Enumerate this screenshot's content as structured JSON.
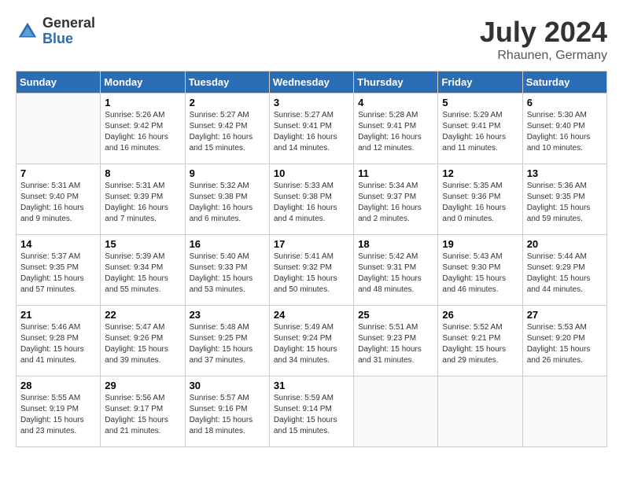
{
  "logo": {
    "general": "General",
    "blue": "Blue"
  },
  "title": {
    "month_year": "July 2024",
    "location": "Rhaunen, Germany"
  },
  "header_days": [
    "Sunday",
    "Monday",
    "Tuesday",
    "Wednesday",
    "Thursday",
    "Friday",
    "Saturday"
  ],
  "weeks": [
    {
      "days": [
        {
          "number": "",
          "info": ""
        },
        {
          "number": "1",
          "info": "Sunrise: 5:26 AM\nSunset: 9:42 PM\nDaylight: 16 hours\nand 16 minutes."
        },
        {
          "number": "2",
          "info": "Sunrise: 5:27 AM\nSunset: 9:42 PM\nDaylight: 16 hours\nand 15 minutes."
        },
        {
          "number": "3",
          "info": "Sunrise: 5:27 AM\nSunset: 9:41 PM\nDaylight: 16 hours\nand 14 minutes."
        },
        {
          "number": "4",
          "info": "Sunrise: 5:28 AM\nSunset: 9:41 PM\nDaylight: 16 hours\nand 12 minutes."
        },
        {
          "number": "5",
          "info": "Sunrise: 5:29 AM\nSunset: 9:41 PM\nDaylight: 16 hours\nand 11 minutes."
        },
        {
          "number": "6",
          "info": "Sunrise: 5:30 AM\nSunset: 9:40 PM\nDaylight: 16 hours\nand 10 minutes."
        }
      ]
    },
    {
      "days": [
        {
          "number": "7",
          "info": "Sunrise: 5:31 AM\nSunset: 9:40 PM\nDaylight: 16 hours\nand 9 minutes."
        },
        {
          "number": "8",
          "info": "Sunrise: 5:31 AM\nSunset: 9:39 PM\nDaylight: 16 hours\nand 7 minutes."
        },
        {
          "number": "9",
          "info": "Sunrise: 5:32 AM\nSunset: 9:38 PM\nDaylight: 16 hours\nand 6 minutes."
        },
        {
          "number": "10",
          "info": "Sunrise: 5:33 AM\nSunset: 9:38 PM\nDaylight: 16 hours\nand 4 minutes."
        },
        {
          "number": "11",
          "info": "Sunrise: 5:34 AM\nSunset: 9:37 PM\nDaylight: 16 hours\nand 2 minutes."
        },
        {
          "number": "12",
          "info": "Sunrise: 5:35 AM\nSunset: 9:36 PM\nDaylight: 16 hours\nand 0 minutes."
        },
        {
          "number": "13",
          "info": "Sunrise: 5:36 AM\nSunset: 9:35 PM\nDaylight: 15 hours\nand 59 minutes."
        }
      ]
    },
    {
      "days": [
        {
          "number": "14",
          "info": "Sunrise: 5:37 AM\nSunset: 9:35 PM\nDaylight: 15 hours\nand 57 minutes."
        },
        {
          "number": "15",
          "info": "Sunrise: 5:39 AM\nSunset: 9:34 PM\nDaylight: 15 hours\nand 55 minutes."
        },
        {
          "number": "16",
          "info": "Sunrise: 5:40 AM\nSunset: 9:33 PM\nDaylight: 15 hours\nand 53 minutes."
        },
        {
          "number": "17",
          "info": "Sunrise: 5:41 AM\nSunset: 9:32 PM\nDaylight: 15 hours\nand 50 minutes."
        },
        {
          "number": "18",
          "info": "Sunrise: 5:42 AM\nSunset: 9:31 PM\nDaylight: 15 hours\nand 48 minutes."
        },
        {
          "number": "19",
          "info": "Sunrise: 5:43 AM\nSunset: 9:30 PM\nDaylight: 15 hours\nand 46 minutes."
        },
        {
          "number": "20",
          "info": "Sunrise: 5:44 AM\nSunset: 9:29 PM\nDaylight: 15 hours\nand 44 minutes."
        }
      ]
    },
    {
      "days": [
        {
          "number": "21",
          "info": "Sunrise: 5:46 AM\nSunset: 9:28 PM\nDaylight: 15 hours\nand 41 minutes."
        },
        {
          "number": "22",
          "info": "Sunrise: 5:47 AM\nSunset: 9:26 PM\nDaylight: 15 hours\nand 39 minutes."
        },
        {
          "number": "23",
          "info": "Sunrise: 5:48 AM\nSunset: 9:25 PM\nDaylight: 15 hours\nand 37 minutes."
        },
        {
          "number": "24",
          "info": "Sunrise: 5:49 AM\nSunset: 9:24 PM\nDaylight: 15 hours\nand 34 minutes."
        },
        {
          "number": "25",
          "info": "Sunrise: 5:51 AM\nSunset: 9:23 PM\nDaylight: 15 hours\nand 31 minutes."
        },
        {
          "number": "26",
          "info": "Sunrise: 5:52 AM\nSunset: 9:21 PM\nDaylight: 15 hours\nand 29 minutes."
        },
        {
          "number": "27",
          "info": "Sunrise: 5:53 AM\nSunset: 9:20 PM\nDaylight: 15 hours\nand 26 minutes."
        }
      ]
    },
    {
      "days": [
        {
          "number": "28",
          "info": "Sunrise: 5:55 AM\nSunset: 9:19 PM\nDaylight: 15 hours\nand 23 minutes."
        },
        {
          "number": "29",
          "info": "Sunrise: 5:56 AM\nSunset: 9:17 PM\nDaylight: 15 hours\nand 21 minutes."
        },
        {
          "number": "30",
          "info": "Sunrise: 5:57 AM\nSunset: 9:16 PM\nDaylight: 15 hours\nand 18 minutes."
        },
        {
          "number": "31",
          "info": "Sunrise: 5:59 AM\nSunset: 9:14 PM\nDaylight: 15 hours\nand 15 minutes."
        },
        {
          "number": "",
          "info": ""
        },
        {
          "number": "",
          "info": ""
        },
        {
          "number": "",
          "info": ""
        }
      ]
    }
  ]
}
